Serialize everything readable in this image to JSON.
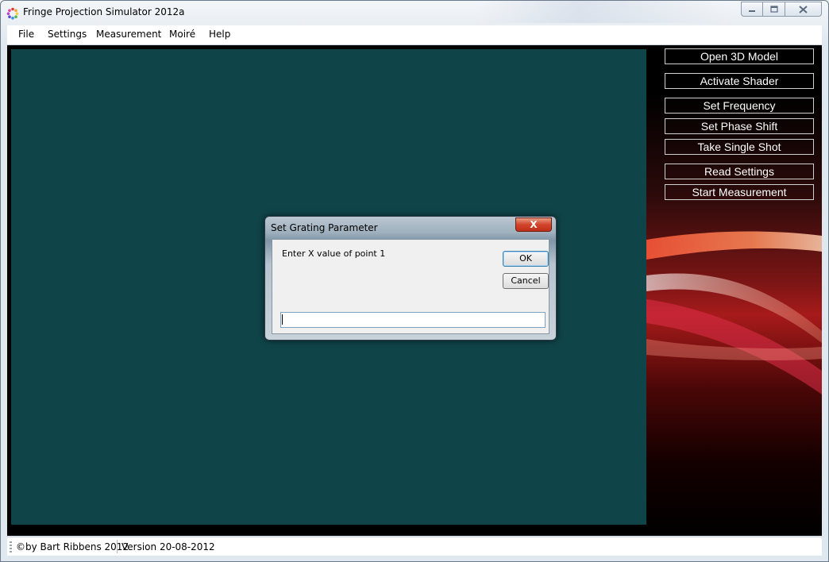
{
  "window": {
    "title": "Fringe Projection Simulator 2012a"
  },
  "menu": [
    "File",
    "Settings",
    "Measurement",
    "Moiré",
    "Help"
  ],
  "sidebar": {
    "buttons": [
      "Open 3D Model",
      "Activate Shader",
      "Set Frequency",
      "Set Phase Shift",
      "Take Single Shot",
      "Read Settings",
      "Start Measurement"
    ]
  },
  "status": {
    "left": "©by Bart Ribbens 2012",
    "right": "Version 20-08-2012"
  },
  "dialog": {
    "title": "Set Grating Parameter",
    "prompt": "Enter X value of point 1",
    "ok": "OK",
    "cancel": "Cancel",
    "input_value": "",
    "close_glyph": "X"
  },
  "colors": {
    "canvas": "#0f4449",
    "accent_red": "#c1301a"
  }
}
